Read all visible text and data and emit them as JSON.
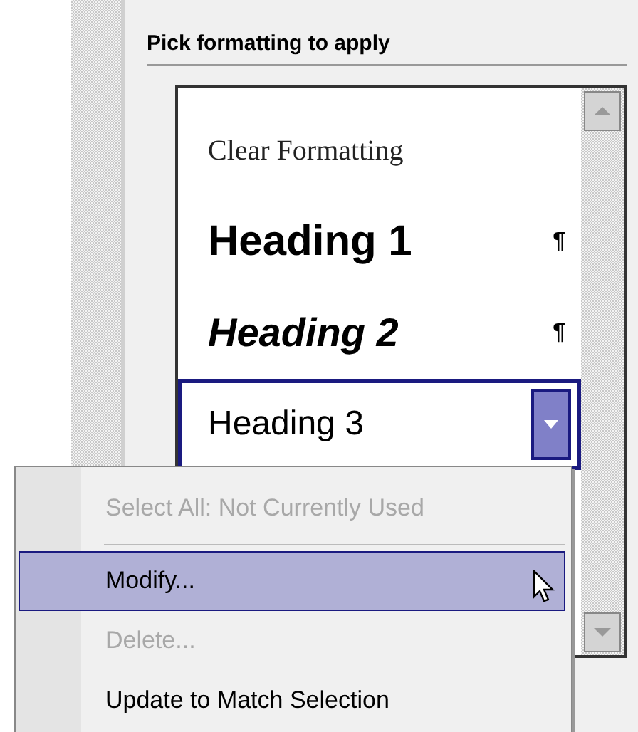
{
  "pane": {
    "title": "Pick formatting to apply",
    "styles": [
      {
        "label": "Clear Formatting",
        "kind": "clear",
        "selected": false
      },
      {
        "label": "Heading 1",
        "kind": "heading1",
        "selected": false,
        "mark": "¶"
      },
      {
        "label": "Heading 2",
        "kind": "heading2",
        "selected": false,
        "mark": "¶"
      },
      {
        "label": "Heading 3",
        "kind": "heading3",
        "selected": true
      }
    ]
  },
  "context_menu": {
    "items": [
      {
        "kind": "item",
        "label": "Select All: Not Currently Used",
        "disabled": true,
        "selected": false
      },
      {
        "kind": "separator"
      },
      {
        "kind": "item",
        "label": "Modify...",
        "disabled": false,
        "selected": true
      },
      {
        "kind": "item",
        "label": "Delete...",
        "disabled": true,
        "selected": false
      },
      {
        "kind": "item",
        "label": "Update to Match Selection",
        "disabled": false,
        "selected": false
      }
    ]
  }
}
